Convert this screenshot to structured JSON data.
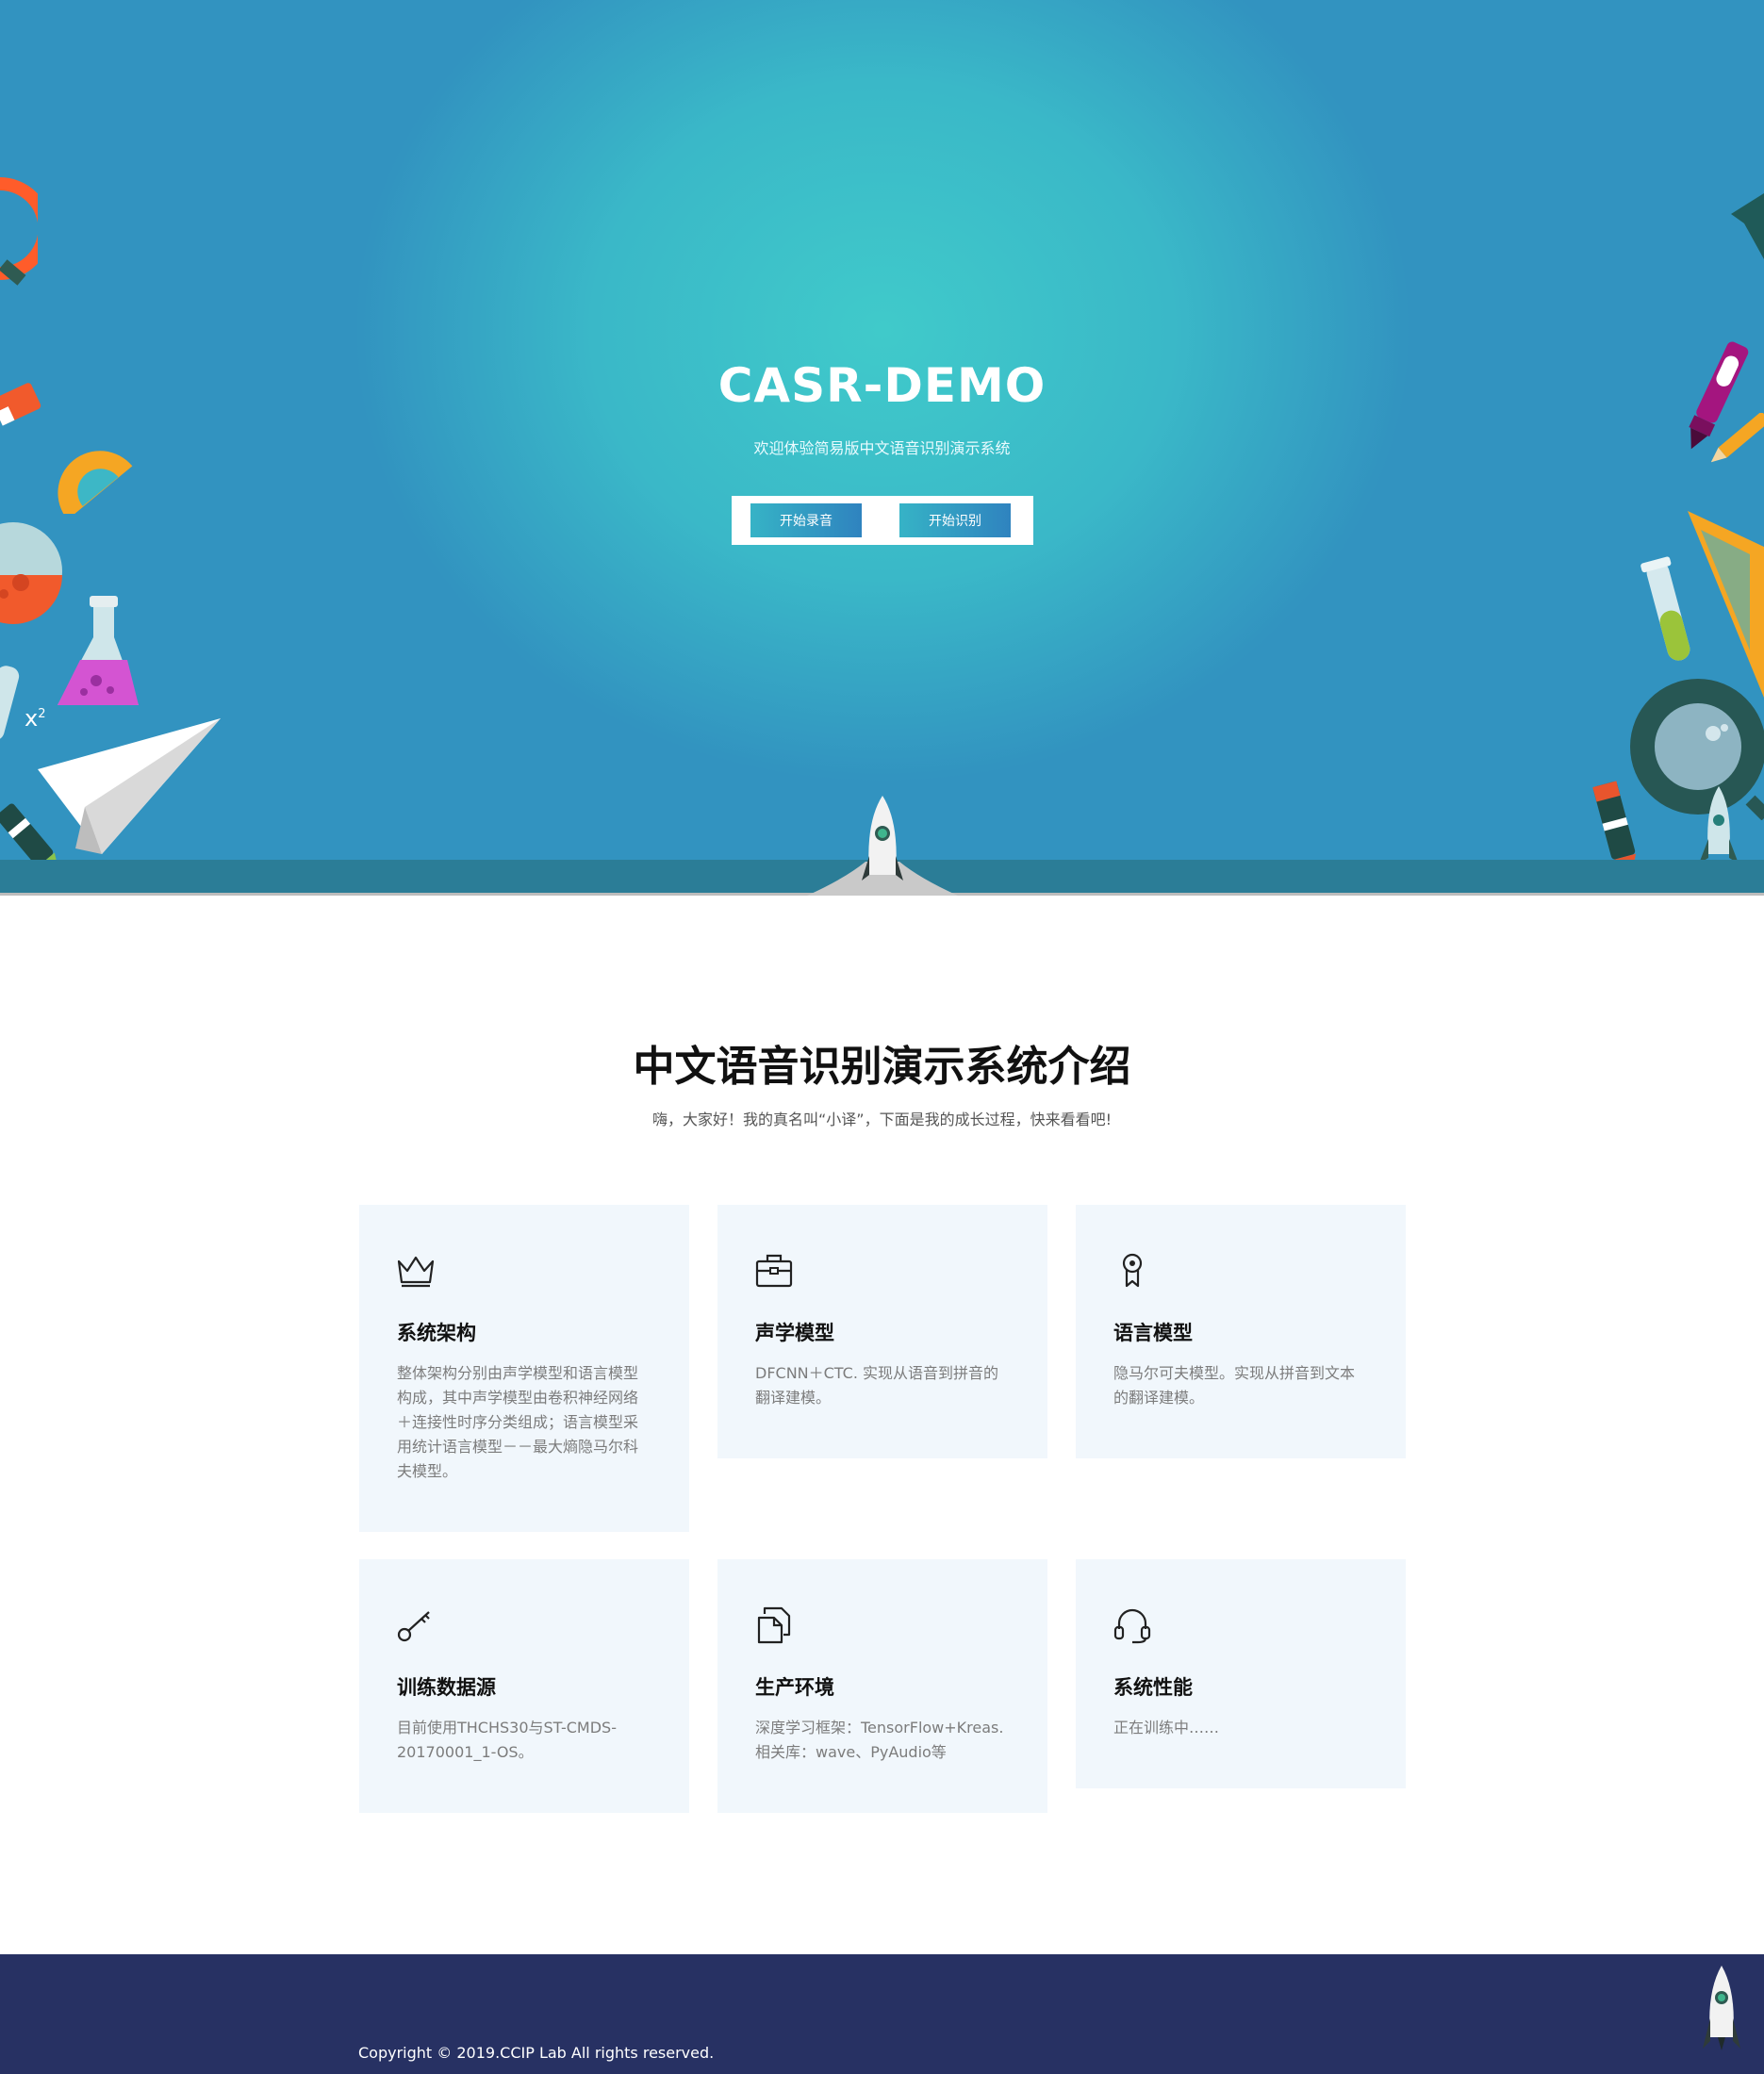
{
  "hero": {
    "title": "CASR-DEMO",
    "subtitle": "欢迎体验简易版中文语音识别演示系统",
    "record_button": "开始录音",
    "recognize_button": "开始识别",
    "superscript_text": "x",
    "superscript_power": "2"
  },
  "intro": {
    "title": "中文语音识别演示系统介绍",
    "subtitle": "嗨，大家好！我的真名叫“小译”，下面是我的成长过程，快来看看吧!"
  },
  "cards": [
    {
      "icon": "crown-icon",
      "title": "系统架构",
      "desc": "整体架构分别由声学模型和语言模型构成，其中声学模型由卷积神经网络＋连接性时序分类组成；语言模型采用统计语言模型－－最大熵隐马尔科夫模型。"
    },
    {
      "icon": "briefcase-icon",
      "title": "声学模型",
      "desc": "DFCNN＋CTC. 实现从语音到拼音的翻译建模。"
    },
    {
      "icon": "award-icon",
      "title": "语言模型",
      "desc": "隐马尔可夫模型。实现从拼音到文本的翻译建模。"
    },
    {
      "icon": "key-icon",
      "title": "训练数据源",
      "desc": "目前使用THCHS30与ST-CMDS-20170001_1-OS。"
    },
    {
      "icon": "documents-icon",
      "title": "生产环境",
      "desc": "深度学习框架：TensorFlow+Kreas.相关库：wave、PyAudio等"
    },
    {
      "icon": "headphones-icon",
      "title": "系统性能",
      "desc": "正在训练中……"
    }
  ],
  "footer": {
    "copyright": "Copyright © 2019.CCIP Lab All rights reserved."
  },
  "colors": {
    "hero_center": "#40caca",
    "hero_edge": "#3293c0",
    "button_gradient_start": "#36b3c6",
    "button_gradient_end": "#2f83bf",
    "card_bg": "#f1f7fc",
    "footer_bg": "#273163"
  }
}
